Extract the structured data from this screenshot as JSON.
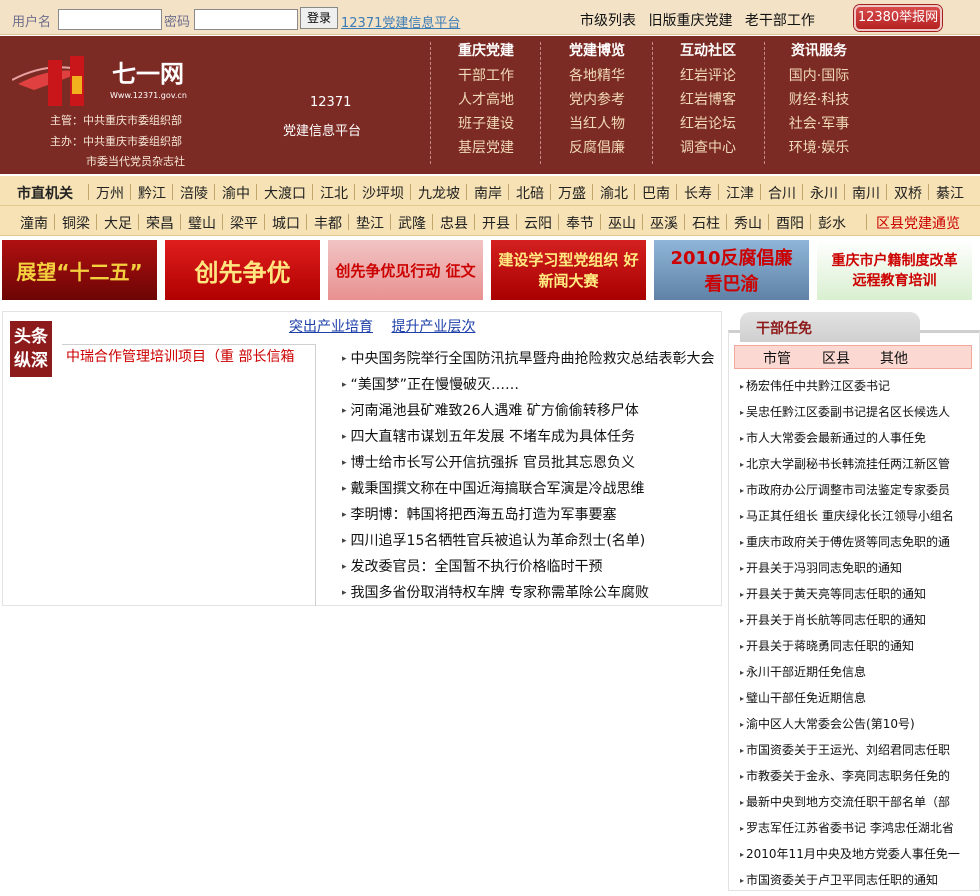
{
  "login": {
    "username_label": "用户名",
    "password_label": "密码",
    "login_button": "登录",
    "platform_link": "12371党建信息平台",
    "top_links": [
      "市级列表",
      "旧版重庆党建",
      "老干部工作"
    ],
    "report_button": "12380举报网"
  },
  "header": {
    "logo_text": "七一网",
    "logo_url": "Www.12371.gov.cn",
    "org_lines": [
      "主管：中共重庆市委组织部",
      "主办：中共重庆市委组织部",
      "市委当代党员杂志社"
    ],
    "platform_line1": "12371",
    "platform_line2": "党建信息平台",
    "nav": [
      {
        "title": "重庆党建",
        "items": [
          "干部工作",
          "人才高地",
          "班子建设",
          "基层党建"
        ]
      },
      {
        "title": "党建博览",
        "items": [
          "各地精华",
          "党内参考",
          "当红人物",
          "反腐倡廉"
        ]
      },
      {
        "title": "互动社区",
        "items": [
          "红岩评论",
          "红岩博客",
          "红岩论坛",
          "调查中心"
        ]
      },
      {
        "title": "资讯服务",
        "items": [
          "国内·国际",
          "财经·科技",
          "社会·军事",
          "环境·娱乐"
        ]
      }
    ]
  },
  "districts": {
    "row1": [
      "市直机关",
      "万州",
      "黔江",
      "涪陵",
      "渝中",
      "大渡口",
      "江北",
      "沙坪坝",
      "九龙坡",
      "南岸",
      "北碚",
      "万盛",
      "渝北",
      "巴南",
      "长寿",
      "江津",
      "合川",
      "永川",
      "南川",
      "双桥",
      "綦江"
    ],
    "row2": [
      "潼南",
      "铜梁",
      "大足",
      "荣昌",
      "璧山",
      "梁平",
      "城口",
      "丰都",
      "垫江",
      "武隆",
      "忠县",
      "开县",
      "云阳",
      "奉节",
      "巫山",
      "巫溪",
      "石柱",
      "秀山",
      "酉阳",
      "彭水",
      "区县党建通览"
    ]
  },
  "banners": [
    "展望“十二五”",
    "创先争优",
    "创先争优见行动 征文",
    "建设学习型党组织 好新闻大赛",
    "2010反腐倡廉 看巴渝",
    "重庆市户籍制度改革 远程教育培训"
  ],
  "headlines": {
    "tag": "头条纵深",
    "top_links": [
      "突出产业培育",
      "提升产业层次"
    ],
    "feature": "中瑞合作管理培训项目（重  部长信箱",
    "items": [
      "中央国务院举行全国防汛抗旱暨舟曲抢险救灾总结表彰大会",
      "“美国梦”正在慢慢破灭……",
      "河南渑池县矿难致26人遇难  矿方偷偷转移尸体",
      "四大直辖市谋划五年发展  不堵车成为具体任务",
      "博士给市长写公开信抗强拆  官员批其忘恩负义",
      "戴秉国撰文称在中国近海搞联合军演是冷战思维",
      "李明博：韩国将把西海五岛打造为军事要塞",
      "四川追孚15名牺牲官兵被追认为革命烈士(名单)",
      "发改委官员：全国暂不执行价格临时干预",
      "我国多省份取消特权车牌  专家称需革除公车腐败"
    ]
  },
  "cadre": {
    "tab_title": "干部任免",
    "subtabs": [
      "市管",
      "区县",
      "其他"
    ],
    "items": [
      "杨宏伟任中共黔江区委书记",
      "吴忠任黔江区委副书记提名区长候选人",
      "市人大常委会最新通过的人事任免",
      "北京大学副秘书长韩流挂任两江新区管",
      "市政府办公厅调整市司法鉴定专家委员",
      "马正其任组长  重庆绿化长江领导小组名",
      "重庆市政府关于傅佐贤等同志免职的通",
      "开县关于冯羽同志免职的通知",
      "开县关于黄天亮等同志任职的通知",
      "开县关于肖长航等同志任职的通知",
      "开县关于蒋晓勇同志任职的通知",
      "永川干部近期任免信息",
      "璧山干部任免近期信息",
      "渝中区人大常委会公告(第10号)",
      "市国资委关于王运光、刘绍君同志任职",
      "市教委关于金永、李亮同志职务任免的",
      "最新中央到地方交流任职干部名单（部",
      "罗志军任江苏省委书记  李鸿忠任湖北省",
      "2010年11月中央及地方党委人事任免一",
      "市国资委关于卢卫平同志任职的通知"
    ]
  }
}
